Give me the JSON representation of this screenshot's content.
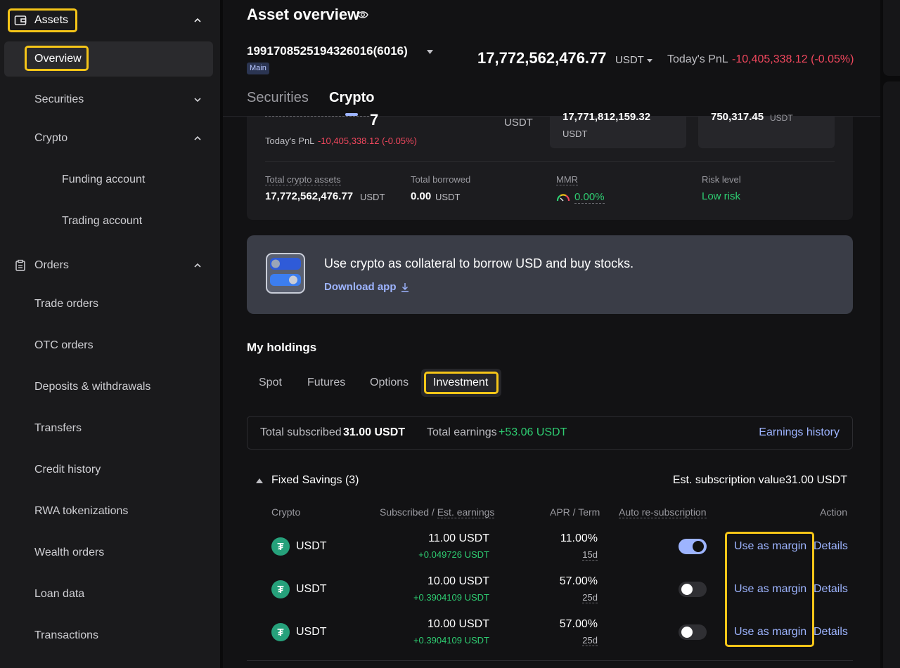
{
  "sidebar": {
    "assets": "Assets",
    "overview": "Overview",
    "securities": "Securities",
    "crypto": "Crypto",
    "funding_account": "Funding account",
    "trading_account": "Trading account",
    "orders": "Orders",
    "trade_orders": "Trade orders",
    "otc_orders": "OTC orders",
    "deposits_withdrawals": "Deposits & withdrawals",
    "transfers": "Transfers",
    "credit_history": "Credit history",
    "rwa_tokenizations": "RWA tokenizations",
    "wealth_orders": "Wealth orders",
    "loan_data": "Loan data",
    "transactions": "Transactions"
  },
  "header": {
    "title": "Asset overview",
    "account_id": "19917085251943260​16(6016)",
    "account_tag": "Main",
    "total_value": "17,772,562,476.77",
    "total_unit": "USDT",
    "pnl_label": "Today's PnL",
    "pnl_value": "-10,405,338.12 (-0.05%)"
  },
  "tabs": {
    "securities": "Securities",
    "crypto": "Crypto"
  },
  "summary": {
    "big_value_fragment": "7",
    "unit_usdt": "USDT",
    "pnl_label": "Today's PnL",
    "pnl_value": "-10,405,338.12 (-0.05%)",
    "card1_value": "17,771,812,159.32",
    "card1_unit": "USDT",
    "card2_value": "750,317.45",
    "card2_unit": "USDT",
    "total_crypto_label": "Total crypto assets",
    "total_crypto_value": "17,772,562,476.77",
    "total_crypto_unit": "USDT",
    "borrowed_label": "Total borrowed",
    "borrowed_value": "0.00",
    "borrowed_unit": "USDT",
    "mmr_label": "MMR",
    "mmr_value": "0.00%",
    "risk_label": "Risk level",
    "risk_value": "Low risk"
  },
  "banner": {
    "text": "Use crypto as collateral to borrow USD and buy stocks.",
    "link": "Download app"
  },
  "holdings": {
    "title": "My holdings",
    "tabs": [
      "Spot",
      "Futures",
      "Options",
      "Investment"
    ],
    "total_subscribed_label": "Total subscribed",
    "total_subscribed_value": "31.00 USDT",
    "total_earnings_label": "Total earnings",
    "total_earnings_value": "+53.06 USDT",
    "earnings_history": "Earnings history"
  },
  "fixed_savings": {
    "title": "Fixed Savings (3)",
    "est_label": "Est. subscription value31.00 USDT",
    "columns": {
      "crypto": "Crypto",
      "subscribed": "Subscribed / ",
      "est_earnings": "Est. earnings",
      "apr": "APR / Term",
      "auto": "Auto re-subscription",
      "action": "Action"
    },
    "rows": [
      {
        "coin": "USDT",
        "subscribed": "11.00 USDT",
        "earnings": "+0.049726 USDT",
        "apr": "11.00%",
        "term": "15d",
        "auto": true,
        "use_margin": "Use as margin",
        "details": "Details"
      },
      {
        "coin": "USDT",
        "subscribed": "10.00 USDT",
        "earnings": "+0.3904109 USDT",
        "apr": "57.00%",
        "term": "25d",
        "auto": false,
        "use_margin": "Use as margin",
        "details": "Details"
      },
      {
        "coin": "USDT",
        "subscribed": "10.00 USDT",
        "earnings": "+0.3904109 USDT",
        "apr": "57.00%",
        "term": "25d",
        "auto": false,
        "use_margin": "Use as margin",
        "details": "Details"
      }
    ]
  },
  "colors": {
    "accent": "#9db4ff",
    "positive": "#2ecc71",
    "negative": "#f0475d",
    "highlight": "#f5c518"
  }
}
